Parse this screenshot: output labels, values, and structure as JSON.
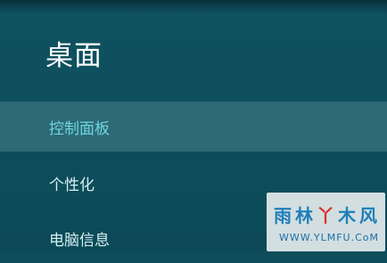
{
  "panel": {
    "title": "桌面",
    "items": [
      {
        "label": "控制面板",
        "selected": true
      },
      {
        "label": "个性化",
        "selected": false
      },
      {
        "label": "电脑信息",
        "selected": false
      }
    ]
  },
  "watermark": {
    "brand_chars": [
      "雨",
      "林",
      "丫",
      "木",
      "风"
    ],
    "url": "WWW.YLMFU.CoM"
  },
  "colors": {
    "background": "#0e4d5a",
    "selected_row": "#2d6a76",
    "selected_text": "#6fd6e0",
    "text": "#d6f0f3"
  }
}
